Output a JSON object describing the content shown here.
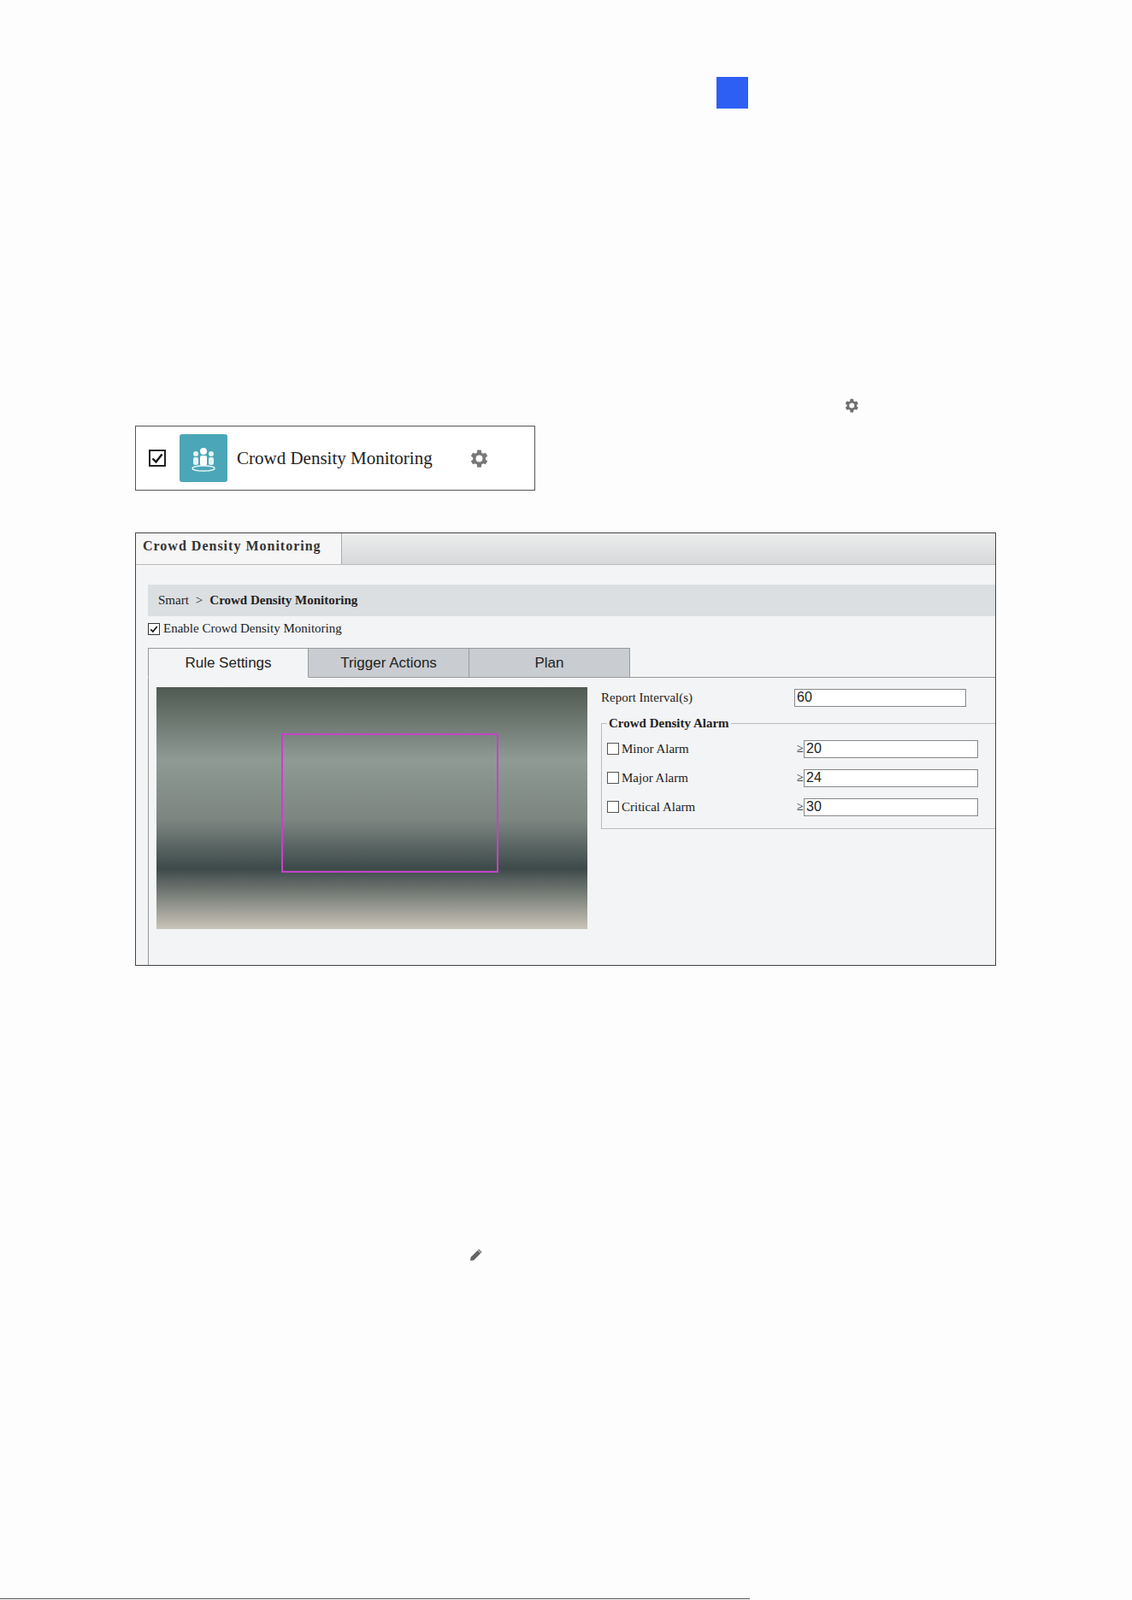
{
  "feature_card": {
    "label": "Crowd Density Monitoring",
    "checked": true
  },
  "panel": {
    "title": "Crowd Density Monitoring",
    "breadcrumb": [
      "Smart",
      "Crowd Density Monitoring"
    ],
    "breadcrumb_separator": ">",
    "enable": {
      "label": "Enable Crowd Density Monitoring",
      "checked": true
    },
    "tabs": [
      {
        "label": "Rule Settings",
        "selected": true
      },
      {
        "label": "Trigger Actions",
        "selected": false
      },
      {
        "label": "Plan",
        "selected": false
      }
    ],
    "report_interval": {
      "label": "Report Interval(s)",
      "value": "60"
    },
    "alarm_group": {
      "title": "Crowd Density Alarm",
      "alarms": [
        {
          "label": "Minor Alarm",
          "checked": false,
          "operator": "≥",
          "value": "20"
        },
        {
          "label": "Major Alarm",
          "checked": false,
          "operator": "≥",
          "value": "24"
        },
        {
          "label": "Critical Alarm",
          "checked": false,
          "operator": "≥",
          "value": "30"
        }
      ]
    }
  }
}
